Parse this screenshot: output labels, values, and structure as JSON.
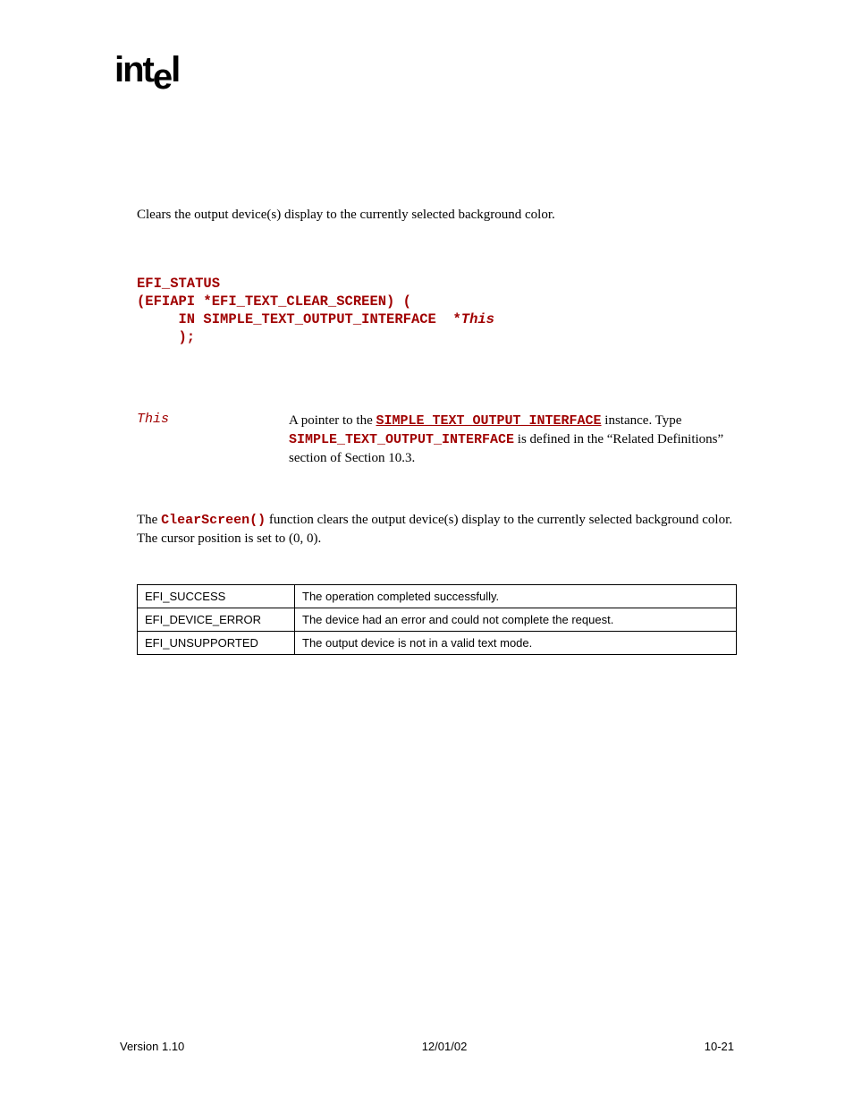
{
  "logo": {
    "left": "int",
    "dropped": "e",
    "right": "l"
  },
  "summary": "Clears the output device(s) display to the currently selected background color.",
  "prototype": {
    "l1": "EFI_STATUS",
    "l2": "(EFIAPI *EFI_TEXT_CLEAR_SCREEN) (",
    "l3a": "     IN SIMPLE_TEXT_OUTPUT_INTERFACE  *",
    "l3b": "This",
    "l4": "     );"
  },
  "parameters": {
    "name": "This",
    "desc_pre": "A pointer to the ",
    "desc_code1": "SIMPLE_TEXT_OUTPUT_INTERFACE",
    "desc_mid1": " instance. Type ",
    "desc_code2": "SIMPLE_TEXT_OUTPUT_INTERFACE",
    "desc_mid2": " is defined in the “Related Definitions” section of Section 10.3."
  },
  "description": {
    "pre": "The ",
    "code": "ClearScreen()",
    "post": " function clears the output device(s) display to the currently selected background color.  The cursor position is set to (0, 0)."
  },
  "status_codes": [
    {
      "code": "EFI_SUCCESS",
      "desc": "The operation completed successfully."
    },
    {
      "code": "EFI_DEVICE_ERROR",
      "desc": "The device had an error and could not complete the request."
    },
    {
      "code": "EFI_UNSUPPORTED",
      "desc": "The output device is not in a valid text mode."
    }
  ],
  "footer": {
    "version": "Version 1.10",
    "date": "12/01/02",
    "page": "10-21"
  }
}
